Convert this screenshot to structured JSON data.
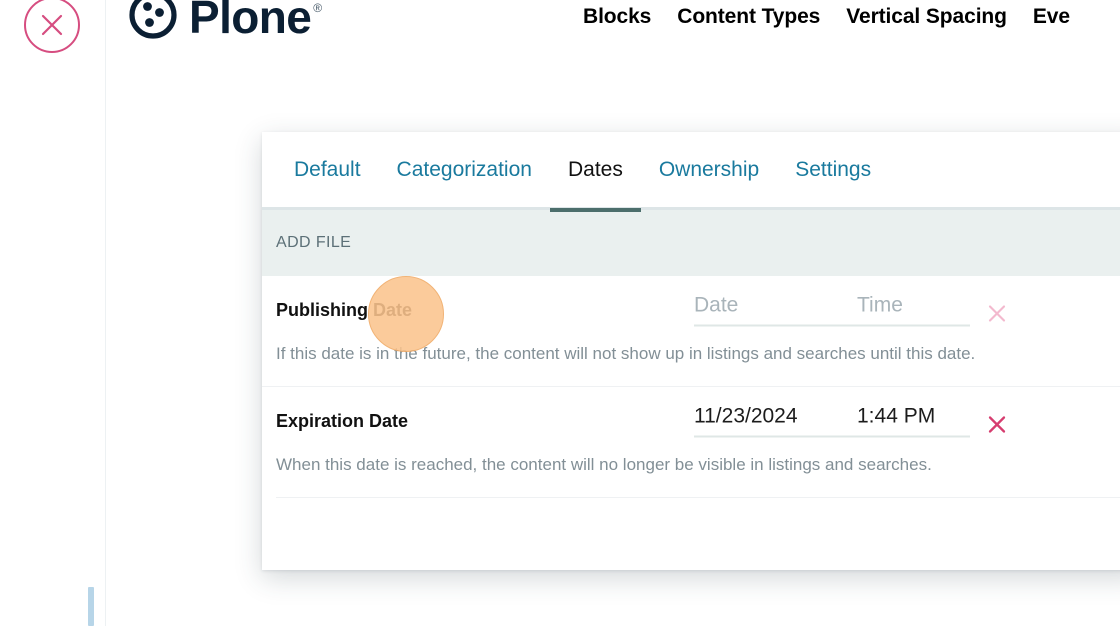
{
  "window": {
    "close_button": "close-icon"
  },
  "brand": {
    "name": "Plone",
    "registered_mark": "®",
    "logo_icon": "plone-logo-icon"
  },
  "top_nav": {
    "items": [
      {
        "label": "Blocks"
      },
      {
        "label": "Content Types"
      },
      {
        "label": "Vertical Spacing"
      },
      {
        "label": "Eve"
      }
    ]
  },
  "edit_panel": {
    "tabs": [
      {
        "label": "Default",
        "active": false
      },
      {
        "label": "Categorization",
        "active": false
      },
      {
        "label": "Dates",
        "active": true
      },
      {
        "label": "Ownership",
        "active": false
      },
      {
        "label": "Settings",
        "active": false
      }
    ],
    "section_header": "ADD FILE",
    "fields": [
      {
        "label": "Publishing Date",
        "date_value": "Date",
        "time_value": "Time",
        "date_is_placeholder": true,
        "clear_icon": "close-icon",
        "help": "If this date is in the future, the content will not show up in listings and searches until this date."
      },
      {
        "label": "Expiration Date",
        "date_value": "11/23/2024",
        "time_value": "1:44 PM",
        "date_is_placeholder": false,
        "clear_icon": "close-icon",
        "help": "When this date is reached, the content will no longer be visible in listings and searches."
      }
    ]
  },
  "colors": {
    "accent_pink": "#d64d80",
    "tab_link": "#1a7a9e",
    "tab_active_underline": "#4c6e6c",
    "section_band": "#eaf0ef",
    "click_highlight": "#fbc48e",
    "left_marker": "#b7d5e8"
  }
}
